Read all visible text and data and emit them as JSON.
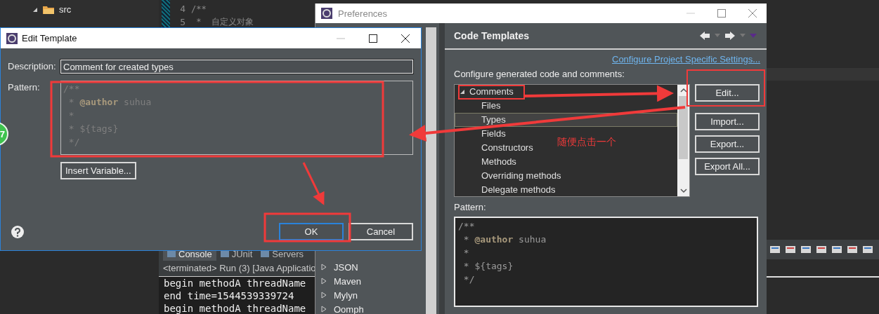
{
  "ide": {
    "explorer": [
      {
        "label": "src",
        "expanded": true
      }
    ],
    "editor": [
      {
        "number": "4",
        "code": "/**"
      },
      {
        "number": "5",
        "code": " *  自定义对象"
      }
    ],
    "badge": "7",
    "console": {
      "tabs": [
        {
          "label": "Console",
          "selected": true
        },
        {
          "label": "JUnit",
          "selected": false
        },
        {
          "label": "Servers",
          "selected": false
        }
      ],
      "status": "<terminated> Run (3) [Java Applicatio",
      "lines": [
        "begin methodA threadName",
        "end time=1544539339724",
        "begin methodA threadName"
      ]
    }
  },
  "preferences": {
    "title": "Preferences",
    "tree_items": [
      {
        "label": "JSON",
        "expanded": false
      },
      {
        "label": "Maven",
        "expanded": false
      },
      {
        "label": "Mylyn",
        "expanded": false
      },
      {
        "label": "Oomph",
        "expanded": false
      }
    ],
    "heading": "Code Templates",
    "link": "Configure Project Specific Settings...",
    "list_label": "Configure generated code and comments:",
    "templates": [
      {
        "label": "Comments",
        "expanded": true,
        "selected": false,
        "children": [
          {
            "label": "Files",
            "selected": false
          },
          {
            "label": "Types",
            "selected": true
          },
          {
            "label": "Fields",
            "selected": false
          },
          {
            "label": "Constructors",
            "selected": false
          },
          {
            "label": "Methods",
            "selected": false
          },
          {
            "label": "Overriding methods",
            "selected": false
          },
          {
            "label": "Delegate methods",
            "selected": false
          }
        ]
      }
    ],
    "buttons": [
      "Edit...",
      "Import...",
      "Export...",
      "Export All..."
    ],
    "pattern_label": "Pattern:",
    "pattern": [
      "/**",
      " * **@author** suhua",
      " *",
      " * ${tags}",
      " */"
    ]
  },
  "edit_template": {
    "title": "Edit Template",
    "description_label": "Description:",
    "description": "Comment for created types",
    "pattern_label": "Pattern:",
    "pattern": [
      "/**",
      " * **@author** suhua",
      " *",
      " * ${tags}",
      " */"
    ],
    "insert_button": "Insert Variable...",
    "ok_button": "OK",
    "cancel_button": "Cancel"
  },
  "annotation": {
    "note": "随便点击一个"
  }
}
